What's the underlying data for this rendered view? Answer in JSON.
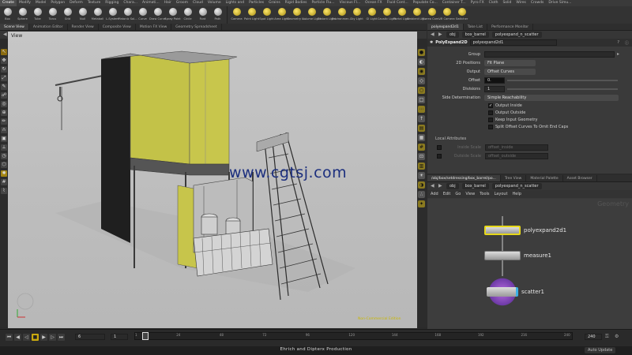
{
  "shelf": {
    "tabs": [
      "Create",
      "Modify",
      "Model",
      "Polygon",
      "Deform",
      "Texture",
      "Rigging",
      "Chara...",
      "Animati...",
      "Hair",
      "Groom",
      "Cloud",
      "Volume",
      "Lights and",
      "Particles",
      "Grains",
      "Rigid Bodies",
      "Particle Flu...",
      "Viscous Fl...",
      "Ocean FX",
      "Fluid Cont...",
      "Populate Co...",
      "Container T...",
      "Pyro FX",
      "Cloth",
      "Solid",
      "Wires",
      "Crowds",
      "Drive Simu..."
    ],
    "left_tools": [
      "Box",
      "Sphere",
      "Tube",
      "Torus",
      "Grid",
      "Null",
      "Metaball",
      "L-System",
      "Platonic Sol...",
      "Curve",
      "Draw Curve",
      "Spray Paint",
      "Circle",
      "Font",
      "Path"
    ],
    "right_tools": [
      "Camera",
      "Point Light",
      "Spot Light",
      "Area Light",
      "Geometry L...",
      "Volume Light",
      "Distant Light",
      "Environmen...",
      "Sky Light",
      "GI Light",
      "Caustic Light",
      "Portal Light",
      "Ambient Lig...",
      "Stereo Cam...",
      "VR Camera",
      "Switcher"
    ]
  },
  "left_pane": {
    "tabs": [
      "Scene View",
      "Animation Editor",
      "Render View",
      "Composite View",
      "Motion FX View",
      "Geometry Spreadsheet"
    ],
    "path": [
      "obj",
      "box"
    ],
    "view_label": "View",
    "watermark": "www.cgtsj.com",
    "edition": "Non-Commercial Edition"
  },
  "param_pane": {
    "tabs": [
      "polyexpand2d1",
      "Take List",
      "Performance Monitor"
    ],
    "path": [
      "obj",
      "box_barrel",
      "polyexpand_n_scatter"
    ],
    "node_type": "PolyExpand2D",
    "node_name": "polyexpand2d1",
    "rows": {
      "group_label": "Group",
      "positions_label": "2D Positions",
      "positions_value": "Fit Plane",
      "output_label": "Output",
      "output_value": "Offset Curves",
      "offset_label": "Offset",
      "offset_value": "0.",
      "divisions_label": "Divisions",
      "divisions_value": "1",
      "side_label": "Side Determination",
      "side_value": "Simple Reachability"
    },
    "checks": [
      {
        "label": "Output Inside",
        "checked": true
      },
      {
        "label": "Output Outside",
        "checked": false
      },
      {
        "label": "Keep Input Geometry",
        "checked": false
      },
      {
        "label": "Split Offset Curves To Omit End Caps",
        "checked": false
      }
    ],
    "local_attributes": "Local Attributes",
    "inside_scale": "Inside Scale",
    "inside_value": "offset_inside",
    "outside_scale": "Outside Scale",
    "outside_value": "offset_outside"
  },
  "net_pane": {
    "tabs": [
      "/obj/box/setdressing/box_barrel/po...",
      "Tree View",
      "Material Palette",
      "Asset Browser"
    ],
    "path": [
      "obj",
      "box_barrel",
      "polyexpand_n_scatter"
    ],
    "menu": [
      "Add",
      "Edit",
      "Go",
      "View",
      "Tools",
      "Layout",
      "Help"
    ],
    "context": "Geometry",
    "nodes": [
      {
        "name": "polyexpand2d1"
      },
      {
        "name": "measure1"
      },
      {
        "name": "scatter1"
      }
    ]
  },
  "timeline": {
    "frame": "6",
    "start": "1",
    "end": "240",
    "ticks": [
      "1",
      "6",
      "24",
      "48",
      "72",
      "96",
      "120",
      "144",
      "168",
      "192",
      "216",
      "240"
    ],
    "end_value": "240"
  },
  "footer": {
    "production": "Ehrich and Dipterx Production",
    "auto_update": "Auto Update"
  }
}
